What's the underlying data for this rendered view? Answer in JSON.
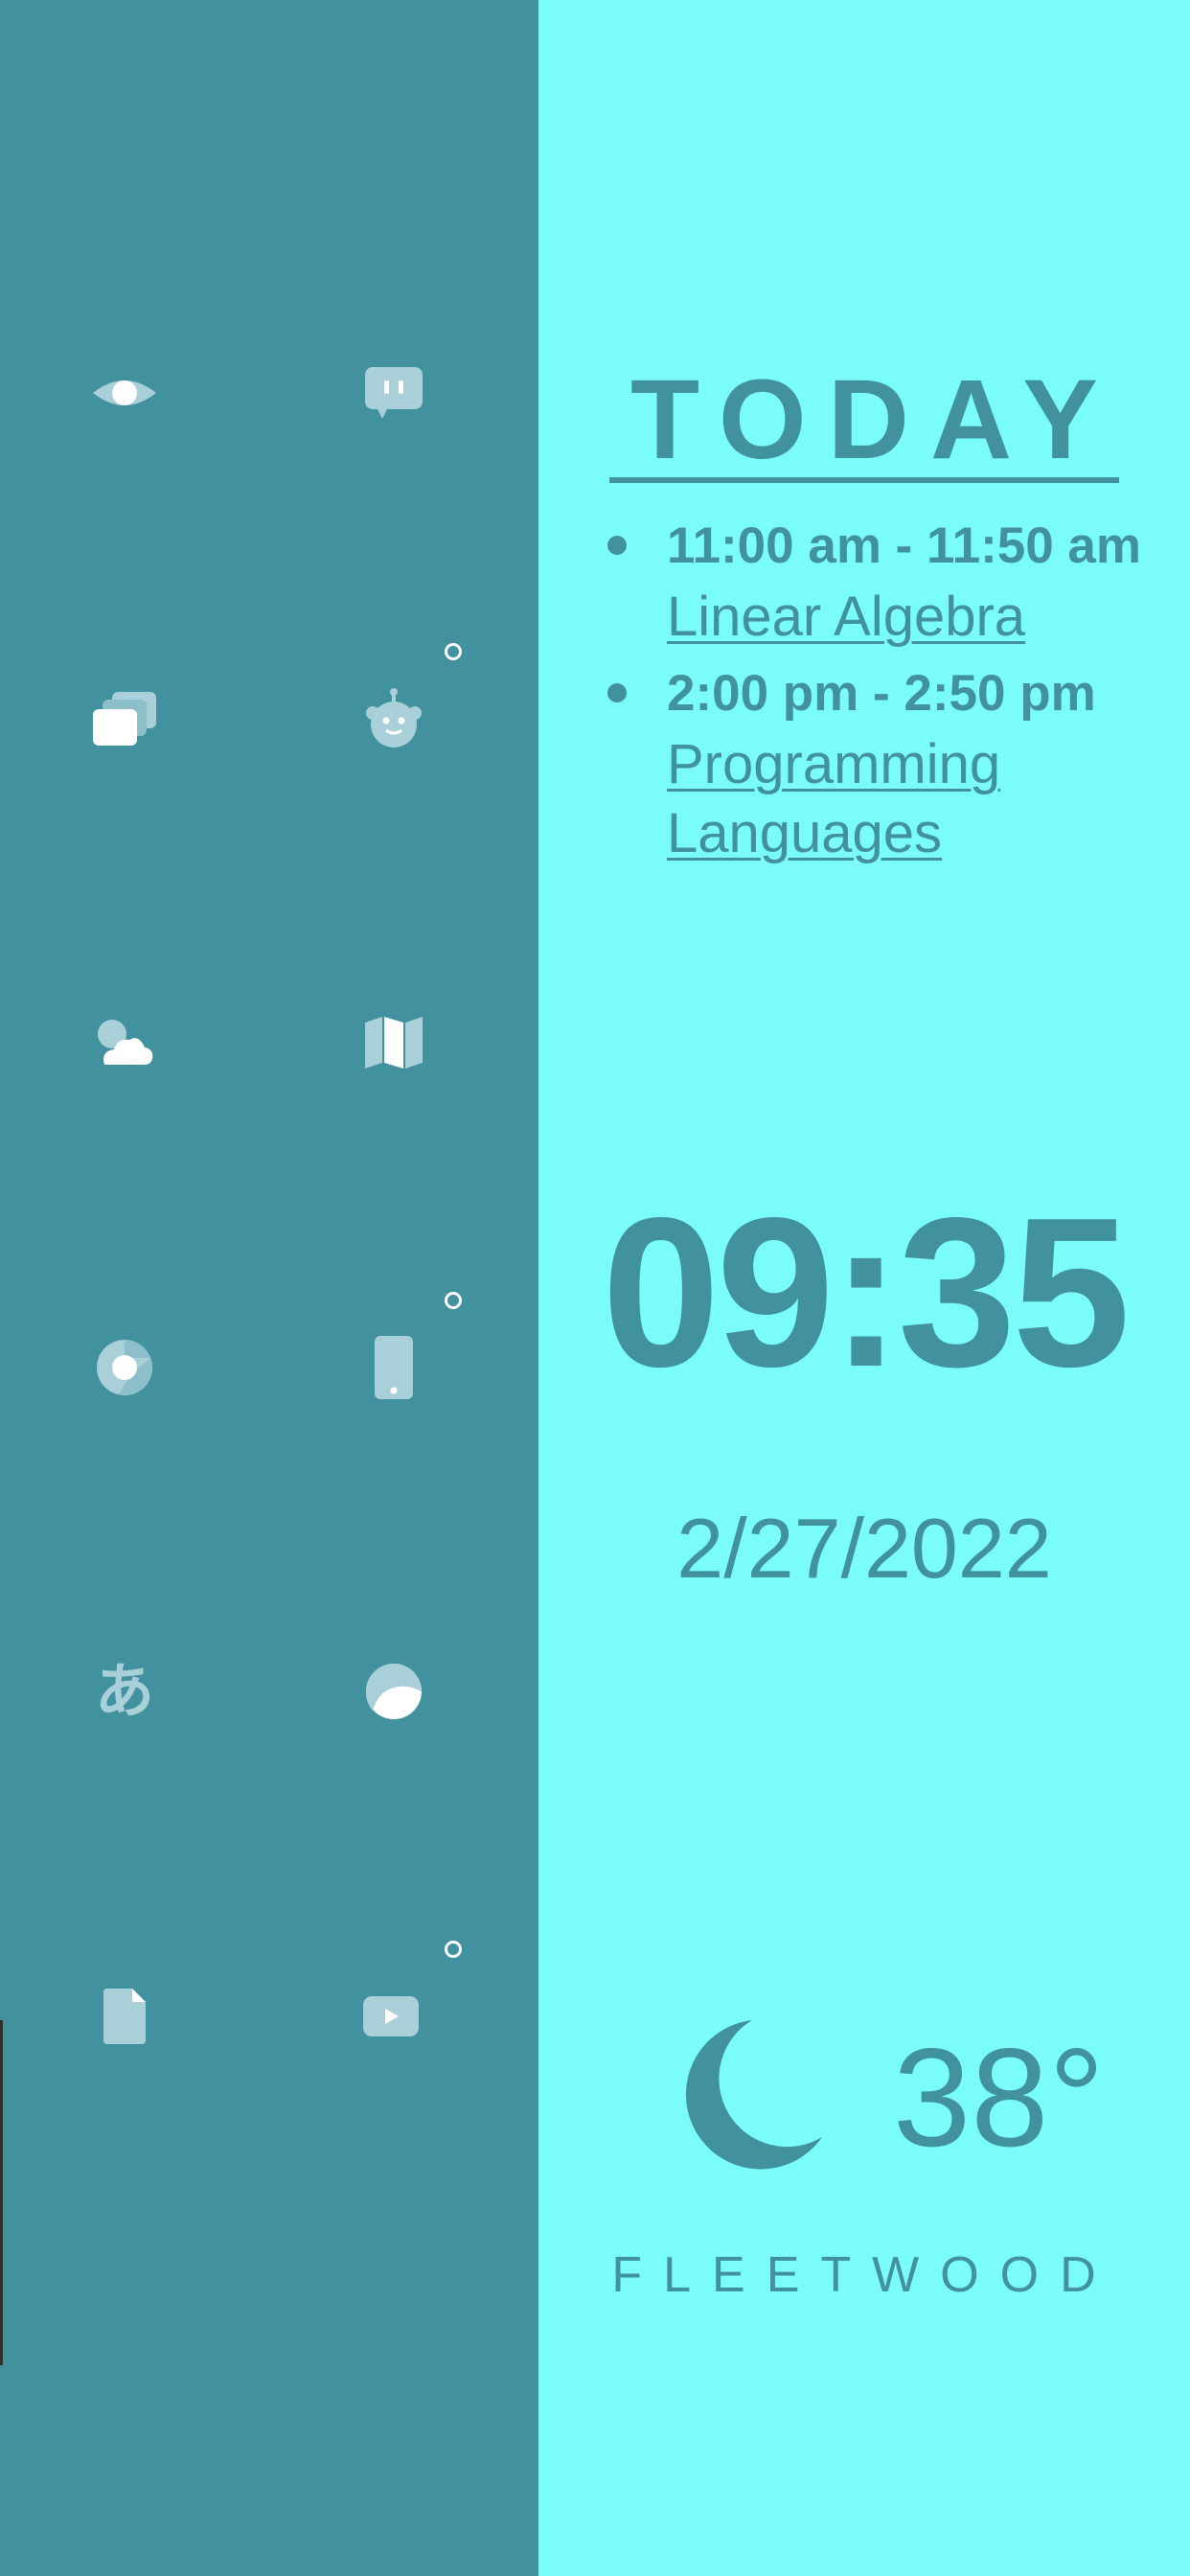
{
  "launcher": {
    "icons": [
      {
        "name": "eye-icon"
      },
      {
        "name": "chat-icon"
      },
      {
        "name": "cards-icon"
      },
      {
        "name": "robot-icon",
        "has_dot": true
      },
      {
        "name": "weather-cloud-icon"
      },
      {
        "name": "map-icon"
      },
      {
        "name": "chrome-icon"
      },
      {
        "name": "phone-icon",
        "has_dot": true
      },
      {
        "name": "hiragana-icon",
        "glyph": "あ"
      },
      {
        "name": "moon-disc-icon"
      },
      {
        "name": "document-icon"
      },
      {
        "name": "youtube-icon",
        "has_dot": true
      }
    ]
  },
  "today": {
    "title": "TODAY",
    "events": [
      {
        "time": "11:00 am - 11:50 am",
        "name": "Linear Algebra"
      },
      {
        "time": "2:00 pm - 2:50 pm",
        "name": "Programming Languages"
      }
    ]
  },
  "clock": {
    "time": "09:35",
    "date": "2/27/2022"
  },
  "weather": {
    "icon": "crescent-moon-icon",
    "temperature": "38°",
    "location": "FLEETWOOD"
  },
  "colors": {
    "panel_dark": "#41919f",
    "panel_light": "#7afcfd",
    "icon_white": "#ffffff",
    "icon_tint": "#a9d0d8"
  }
}
